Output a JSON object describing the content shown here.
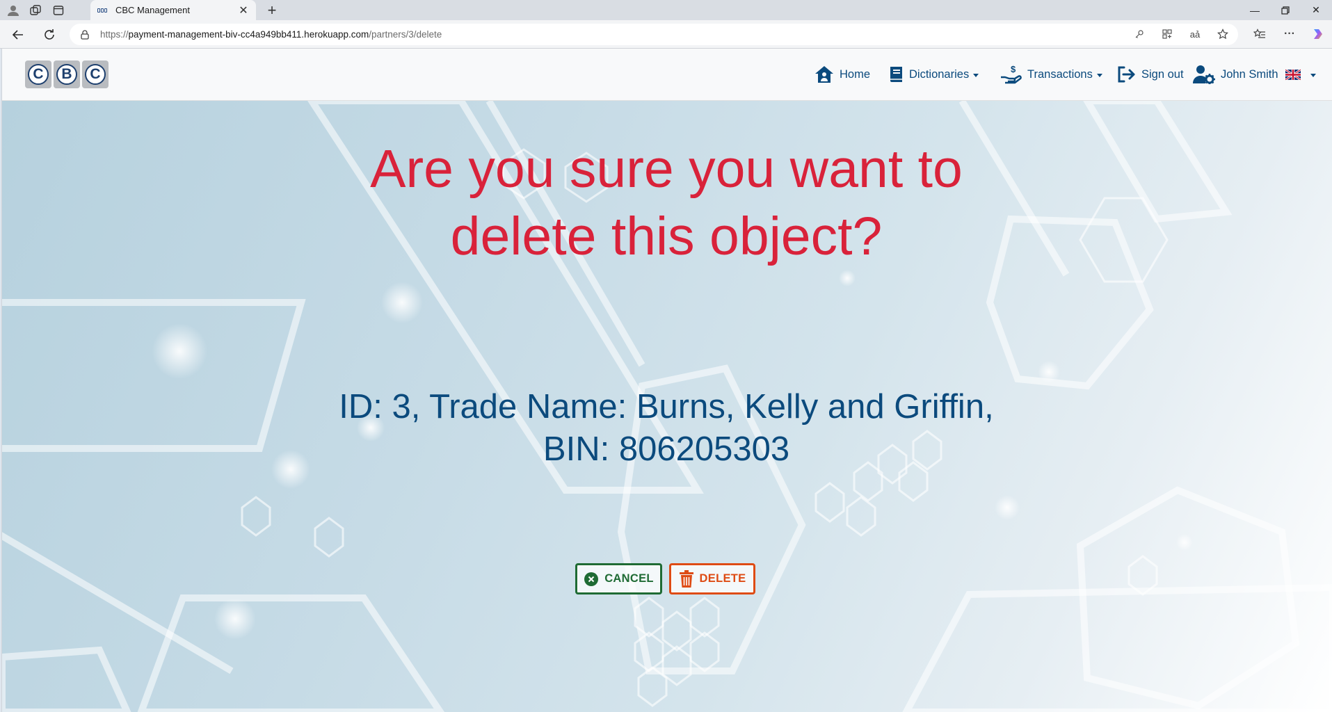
{
  "browser": {
    "tab_title": "CBC Management",
    "url_protocol": "https://",
    "url_host": "payment-management-biv-cc4a949bb411.herokuapp.com",
    "url_path": "/partners/3/delete"
  },
  "navbar": {
    "logo_letters": [
      "C",
      "B",
      "C"
    ],
    "home": "Home",
    "dictionaries": "Dictionaries",
    "transactions": "Transactions",
    "sign_out": "Sign out",
    "user_name": "John Smith",
    "language_flag": "uk-flag"
  },
  "main": {
    "question": "Are you sure you want to delete this object?",
    "object_info_line1": "ID: 3, Trade Name: Burns, Kelly and Griffin,",
    "object_info_line2": "BIN: 806205303",
    "cancel_label": "CANCEL",
    "delete_label": "DELETE"
  },
  "colors": {
    "question": "#d9223a",
    "info": "#0b4a7d",
    "cancel": "#1f6b34",
    "delete": "#de4b14",
    "nav": "#0b4a7d"
  }
}
